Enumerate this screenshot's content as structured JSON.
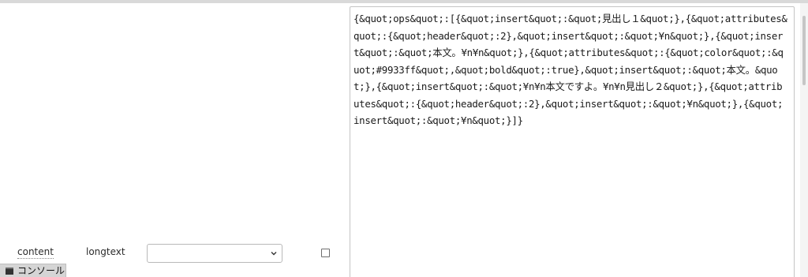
{
  "editor": {
    "content_json": "{&quot;ops&quot;:[{&quot;insert&quot;:&quot;見出し１&quot;},{&quot;attributes&quot;:{&quot;header&quot;:2},&quot;insert&quot;:&quot;¥n&quot;},{&quot;insert&quot;:&quot;本文。¥n¥n&quot;},{&quot;attributes&quot;:{&quot;color&quot;:&quot;#9933ff&quot;,&quot;bold&quot;:true},&quot;insert&quot;:&quot;本文。&quot;},{&quot;insert&quot;:&quot;¥n¥n本文ですよ。¥n¥n見出し２&quot;},{&quot;attributes&quot;:{&quot;header&quot;:2},&quot;insert&quot;:&quot;¥n&quot;},{&quot;insert&quot;:&quot;¥n&quot;}]}"
  },
  "field": {
    "name_label": "content",
    "type_label": "longtext",
    "select_value": ""
  },
  "console": {
    "tab_label": "コンソール"
  },
  "icons": {
    "chevron": "chevron-down-icon",
    "console": "console-window-icon"
  }
}
